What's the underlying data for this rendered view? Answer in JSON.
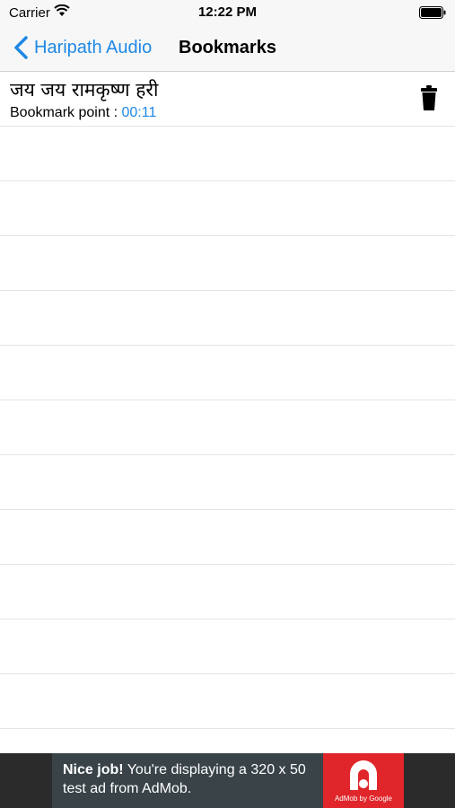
{
  "status_bar": {
    "carrier": "Carrier",
    "time": "12:22 PM",
    "icons": [
      "wifi-icon",
      "battery-icon"
    ]
  },
  "nav": {
    "back_label": "Haripath Audio",
    "title": "Bookmarks",
    "accent_color": "#1e88e5"
  },
  "bookmarks": [
    {
      "title": "जय जय रामकृष्ण हरी",
      "label": "Bookmark point : ",
      "time": "00:11"
    }
  ],
  "ad": {
    "headline": "Nice job!",
    "body": " You're displaying a 320 x 50 test ad from AdMob.",
    "logo_caption": "AdMob by Google",
    "brand_color": "#e0262b"
  }
}
